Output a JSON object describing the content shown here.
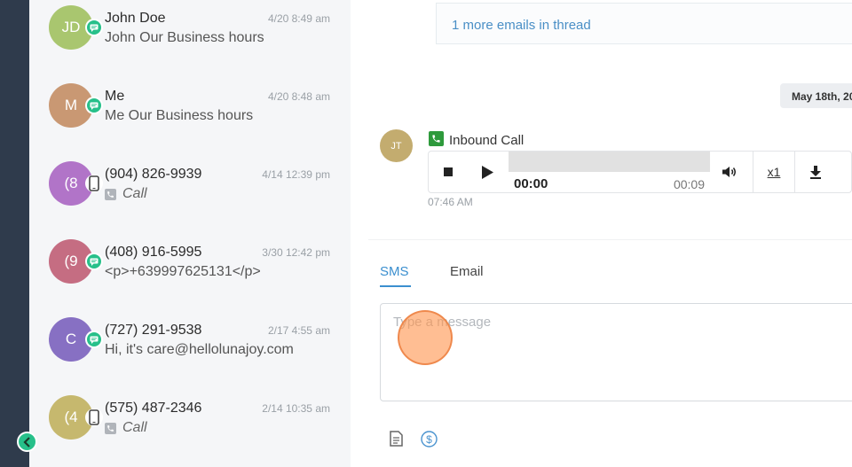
{
  "conversations": [
    {
      "initials": "JD",
      "name": "John Doe",
      "time": "4/20 8:49 am",
      "preview": "John Our Business hours",
      "channel": "sms",
      "avatar_color": "#a9c66f"
    },
    {
      "initials": "M",
      "name": "Me",
      "time": "4/20 8:48 am",
      "preview": "Me Our Business hours",
      "channel": "sms",
      "avatar_color": "#c99873"
    },
    {
      "initials": "(8",
      "name": "(904) 826-9939",
      "time": "4/14 12:39 pm",
      "preview": "Call",
      "channel": "phone",
      "avatar_color": "#b174c8"
    },
    {
      "initials": "(9",
      "name": "(408) 916-5995",
      "time": "3/30 12:42 pm",
      "preview": "<p>+639997625131</p>",
      "channel": "sms",
      "avatar_color": "#c56d82"
    },
    {
      "initials": "C",
      "name": "(727) 291-9538",
      "time": "2/17 4:55 am",
      "preview": "Hi, it's care@hellolunajoy.com",
      "channel": "sms",
      "avatar_color": "#8770c3"
    },
    {
      "initials": "(4",
      "name": "(575) 487-2346",
      "time": "2/14 10:35 am",
      "preview": "Call",
      "channel": "phone",
      "avatar_color": "#c6b86e"
    }
  ],
  "thread": {
    "more_emails": "1 more emails in thread",
    "date_divider": "May 18th, 20"
  },
  "call": {
    "avatar_initials": "JT",
    "title": "Inbound Call",
    "current_time": "00:00",
    "duration": "00:09",
    "playback_rate": "x1",
    "timestamp": "07:46 AM",
    "progress": 0
  },
  "composer": {
    "tabs": [
      "SMS",
      "Email"
    ],
    "active_tab": "SMS",
    "placeholder": "Type a message",
    "value": ""
  },
  "colors": {
    "accent": "#3b8fcf",
    "sms_badge": "#27c08a",
    "rail": "#2f3b4c"
  },
  "icons": {
    "sms": "chat-bubble-icon",
    "phone": "mobile-phone-icon",
    "collapse": "chevron-left-icon",
    "template": "document-icon",
    "payment": "dollar-icon"
  }
}
